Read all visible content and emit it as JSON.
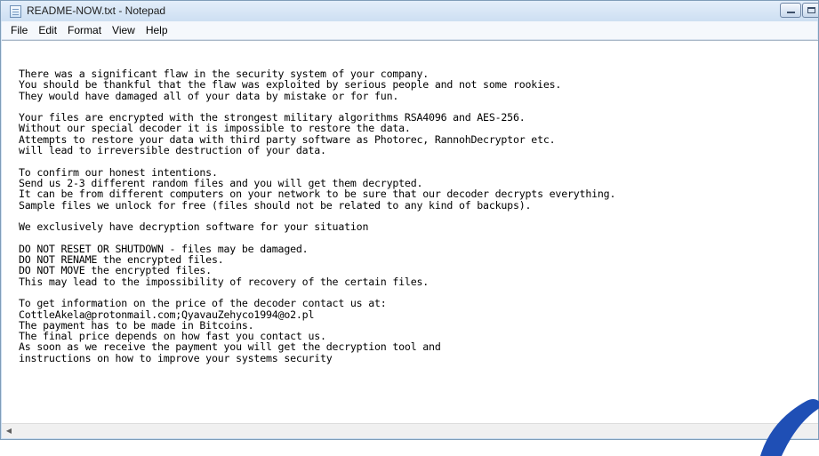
{
  "window": {
    "title": "README-NOW.txt - Notepad"
  },
  "menu": {
    "file": "File",
    "edit": "Edit",
    "format": "Format",
    "view": "View",
    "help": "Help"
  },
  "document": {
    "text": "There was a significant flaw in the security system of your company.\nYou should be thankful that the flaw was exploited by serious people and not some rookies.\nThey would have damaged all of your data by mistake or for fun.\n\nYour files are encrypted with the strongest military algorithms RSA4096 and AES-256.\nWithout our special decoder it is impossible to restore the data.\nAttempts to restore your data with third party software as Photorec, RannohDecryptor etc.\nwill lead to irreversible destruction of your data.\n\nTo confirm our honest intentions.\nSend us 2-3 different random files and you will get them decrypted.\nIt can be from different computers on your network to be sure that our decoder decrypts everything.\nSample files we unlock for free (files should not be related to any kind of backups).\n\nWe exclusively have decryption software for your situation\n\nDO NOT RESET OR SHUTDOWN - files may be damaged.\nDO NOT RENAME the encrypted files.\nDO NOT MOVE the encrypted files.\nThis may lead to the impossibility of recovery of the certain files.\n\nTo get information on the price of the decoder contact us at:\nCottleAkela@protonmail.com;QyavauZehyco1994@o2.pl\nThe payment has to be made in Bitcoins.\nThe final price depends on how fast you contact us.\nAs soon as we receive the payment you will get the decryption tool and\ninstructions on how to improve your systems security"
  },
  "scrollbar": {
    "left_arrow_icon": "chevron-left-icon"
  },
  "colors": {
    "watermark": "#1f4fb5"
  }
}
